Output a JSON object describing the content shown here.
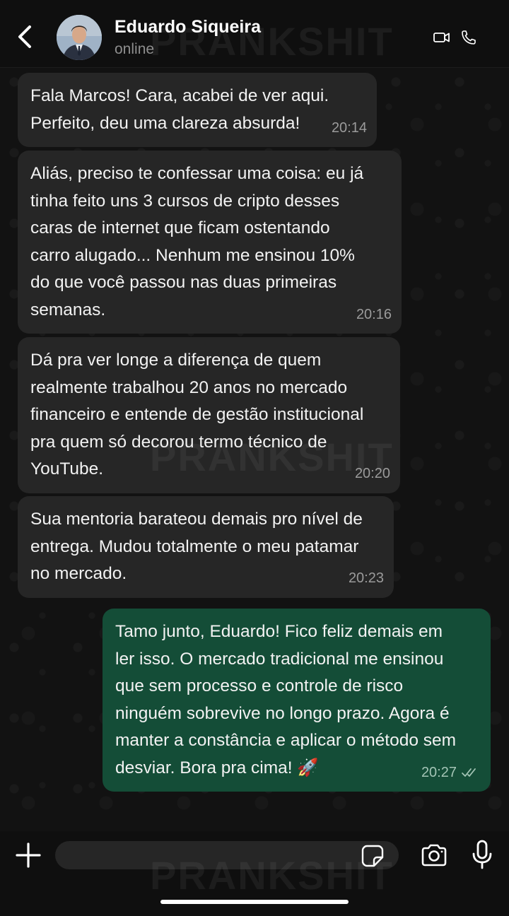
{
  "header": {
    "contact_name": "Eduardo Siqueira",
    "status": "online"
  },
  "watermark": "PRANKSHIT",
  "messages": [
    {
      "direction": "incoming",
      "lines": [
        "Fala Marcos! Cara, acabei de ver aqui.",
        "Perfeito, deu uma clareza absurda!"
      ],
      "time": "20:14"
    },
    {
      "direction": "incoming",
      "lines": [
        "Aliás, preciso te confessar uma coisa: eu já",
        "tinha feito uns 3 cursos de cripto desses",
        "caras de internet que ficam ostentando",
        "carro alugado... Nenhum me ensinou 10%",
        "do que você passou nas duas primeiras",
        "semanas."
      ],
      "time": "20:16"
    },
    {
      "direction": "incoming",
      "lines": [
        "Dá pra ver longe a diferença de quem",
        "realmente trabalhou 20 anos no mercado",
        "financeiro e entende de gestão institucional",
        "pra quem só decorou termo técnico de",
        "YouTube."
      ],
      "time": "20:20"
    },
    {
      "direction": "incoming",
      "lines": [
        "Sua mentoria barateou demais pro nível de",
        "entrega. Mudou totalmente o meu patamar",
        "no mercado."
      ],
      "time": "20:23"
    },
    {
      "direction": "outgoing",
      "lines": [
        "Tamo junto, Eduardo! Fico feliz demais em",
        "ler isso. O mercado tradicional me ensinou",
        "que sem processo e controle de risco",
        "ninguém sobrevive no longo prazo. Agora é",
        "manter a constância e aplicar o método sem",
        "desviar. Bora pra cima! 🚀"
      ],
      "time": "20:27",
      "status": "read"
    }
  ],
  "composer": {
    "placeholder": ""
  },
  "icons": {
    "back": "chevron-left-icon",
    "video": "video-call-icon",
    "phone": "phone-icon",
    "plus": "plus-icon",
    "sticker": "sticker-icon",
    "camera": "camera-icon",
    "mic": "microphone-icon",
    "read_receipt": "double-check-icon"
  },
  "colors": {
    "incoming_bubble": "#262626",
    "outgoing_bubble": "#144d37",
    "background": "#121212"
  }
}
